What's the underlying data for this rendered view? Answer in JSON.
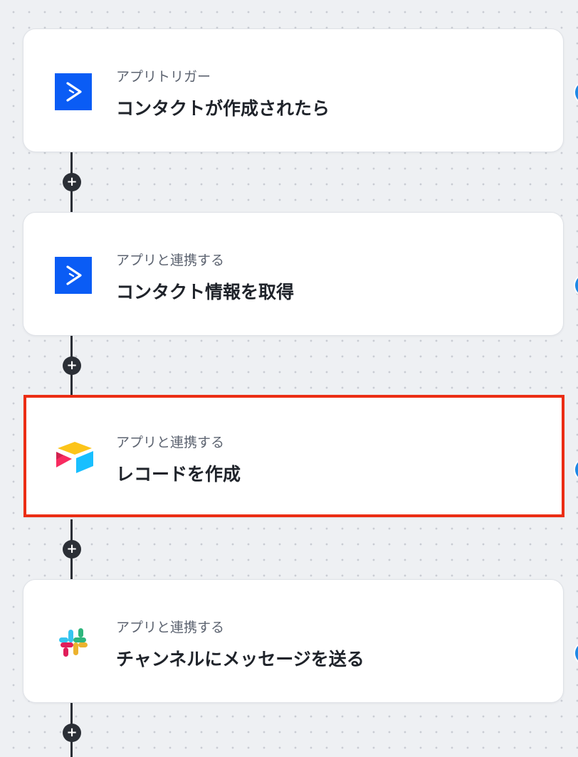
{
  "colors": {
    "activecampaign_blue": "#0a5cf5",
    "selection_red": "#eb2d14",
    "connector": "#2b2f36",
    "side_dot_blue": "#1e88e5"
  },
  "flow": {
    "steps": [
      {
        "subtitle": "アプリトリガー",
        "title": "コンタクトが作成されたら",
        "icon": "activecampaign-icon",
        "selected": false
      },
      {
        "subtitle": "アプリと連携する",
        "title": "コンタクト情報を取得",
        "icon": "activecampaign-icon",
        "selected": false
      },
      {
        "subtitle": "アプリと連携する",
        "title": "レコードを作成",
        "icon": "airtable-icon",
        "selected": true
      },
      {
        "subtitle": "アプリと連携する",
        "title": "チャンネルにメッセージを送る",
        "icon": "slack-icon",
        "selected": false
      }
    ],
    "add_step_symbol": "+"
  }
}
